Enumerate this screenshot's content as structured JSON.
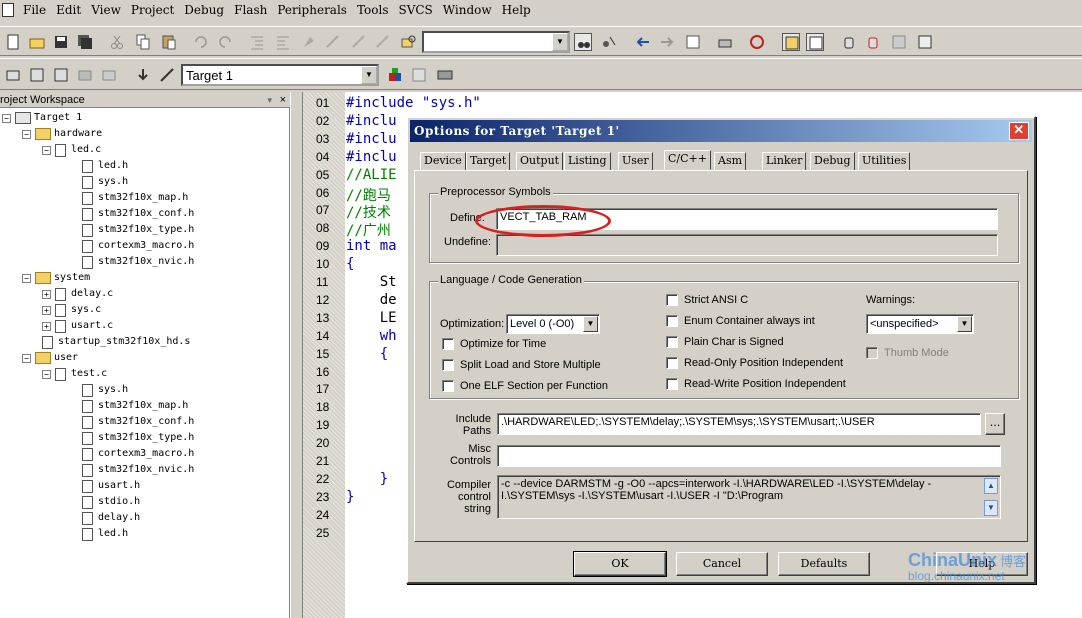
{
  "menu": {
    "items": [
      "File",
      "Edit",
      "View",
      "Project",
      "Debug",
      "Flash",
      "Peripherals",
      "Tools",
      "SVCS",
      "Window",
      "Help"
    ]
  },
  "toolbar2": {
    "target_combo": "Target 1"
  },
  "workspace": {
    "title": "roject Workspace",
    "close": "×",
    "pin": "▾",
    "tree": [
      {
        "label": "Target 1",
        "type": "target",
        "toggle": "−"
      },
      {
        "label": "hardware",
        "type": "folder",
        "toggle": "−"
      },
      {
        "label": "led.c",
        "type": "file",
        "toggle": "−"
      },
      {
        "label": "led.h",
        "type": "file"
      },
      {
        "label": "sys.h",
        "type": "file"
      },
      {
        "label": "stm32f10x_map.h",
        "type": "file"
      },
      {
        "label": "stm32f10x_conf.h",
        "type": "file"
      },
      {
        "label": "stm32f10x_type.h",
        "type": "file"
      },
      {
        "label": "cortexm3_macro.h",
        "type": "file"
      },
      {
        "label": "stm32f10x_nvic.h",
        "type": "file"
      },
      {
        "label": "system",
        "type": "folder",
        "toggle": "−"
      },
      {
        "label": "delay.c",
        "type": "file",
        "toggle": "+"
      },
      {
        "label": "sys.c",
        "type": "file",
        "toggle": "+"
      },
      {
        "label": "usart.c",
        "type": "file",
        "toggle": "+"
      },
      {
        "label": "startup_stm32f10x_hd.s",
        "type": "file"
      },
      {
        "label": "user",
        "type": "folder",
        "toggle": "−"
      },
      {
        "label": "test.c",
        "type": "file",
        "toggle": "−"
      },
      {
        "label": "sys.h",
        "type": "file"
      },
      {
        "label": "stm32f10x_map.h",
        "type": "file"
      },
      {
        "label": "stm32f10x_conf.h",
        "type": "file"
      },
      {
        "label": "stm32f10x_type.h",
        "type": "file"
      },
      {
        "label": "cortexm3_macro.h",
        "type": "file"
      },
      {
        "label": "stm32f10x_nvic.h",
        "type": "file"
      },
      {
        "label": "usart.h",
        "type": "file"
      },
      {
        "label": "stdio.h",
        "type": "file"
      },
      {
        "label": "delay.h",
        "type": "file"
      },
      {
        "label": "led.h",
        "type": "file"
      }
    ]
  },
  "editor": {
    "line_numbers": [
      "01",
      "02",
      "03",
      "04",
      "05",
      "06",
      "07",
      "08",
      "09",
      "10",
      "11",
      "12",
      "13",
      "14",
      "15",
      "16",
      "17",
      "18",
      "19",
      "20",
      "21",
      "22",
      "23",
      "24",
      "25"
    ],
    "lines": [
      {
        "text": "#include \"sys.h\"",
        "cls": "kw"
      },
      {
        "text": "#inclu",
        "cls": "kw"
      },
      {
        "text": "#inclu",
        "cls": "kw"
      },
      {
        "text": "#inclu",
        "cls": "kw"
      },
      {
        "text": "//ALIE",
        "cls": "cmt"
      },
      {
        "text": "//跑马",
        "cls": "cmt"
      },
      {
        "text": "//技术",
        "cls": "cmt"
      },
      {
        "text": "//广州",
        "cls": "cmt"
      },
      {
        "text": "int ma",
        "cls": "kw"
      },
      {
        "text": "{",
        "cls": "kw"
      },
      {
        "text": "    St",
        "cls": ""
      },
      {
        "text": "    de",
        "cls": ""
      },
      {
        "text": "    LE",
        "cls": ""
      },
      {
        "text": "    wh",
        "cls": "kw"
      },
      {
        "text": "    {",
        "cls": "kw"
      },
      {
        "text": "",
        "cls": ""
      },
      {
        "text": "",
        "cls": ""
      },
      {
        "text": "",
        "cls": ""
      },
      {
        "text": "",
        "cls": ""
      },
      {
        "text": "",
        "cls": ""
      },
      {
        "text": "",
        "cls": ""
      },
      {
        "text": "    }",
        "cls": "kw"
      },
      {
        "text": "}",
        "cls": "kw"
      },
      {
        "text": "",
        "cls": ""
      },
      {
        "text": "",
        "cls": ""
      }
    ]
  },
  "dialog": {
    "title": "Options for Target 'Target 1'",
    "close": "✕",
    "tabs": [
      "Device",
      "Target",
      "Output",
      "Listing",
      "User",
      "C/C++",
      "Asm",
      "Linker",
      "Debug",
      "Utilities"
    ],
    "active_tab": "C/C++",
    "preprocessor": {
      "group_label": "Preprocessor Symbols",
      "define_label": "Define:",
      "define_value": "VECT_TAB_RAM",
      "undefine_label": "Undefine:",
      "undefine_value": ""
    },
    "language": {
      "group_label": "Language / Code Generation",
      "optimization_label": "Optimization:",
      "optimization_value": "Level 0 (-O0)",
      "optimize_time": "Optimize for Time",
      "split_load": "Split Load and Store Multiple",
      "one_elf": "One ELF Section per Function",
      "strict_ansi": "Strict ANSI C",
      "enum_container": "Enum Container always int",
      "plain_char": "Plain Char is Signed",
      "ro_pi": "Read-Only Position Independent",
      "rw_pi": "Read-Write Position Independent",
      "warnings_label": "Warnings:",
      "warnings_value": "<unspecified>",
      "thumb_mode": "Thumb Mode"
    },
    "include_paths_label": "Include Paths",
    "include_paths_value": ".\\HARDWARE\\LED;.\\SYSTEM\\delay;.\\SYSTEM\\sys;.\\SYSTEM\\usart;.\\USER",
    "browse": "...",
    "misc_label": "Misc Controls",
    "misc_value": "",
    "compiler_label": "Compiler control string",
    "compiler_line1": "-c --device DARMSTM -g -O0 --apcs=interwork -I.\\HARDWARE\\LED -I.\\SYSTEM\\delay -",
    "compiler_line2": "I.\\SYSTEM\\sys -I.\\SYSTEM\\usart -I.\\USER -I \"D:\\Program",
    "buttons": {
      "ok": "OK",
      "cancel": "Cancel",
      "defaults": "Defaults",
      "help": "Help"
    }
  },
  "watermark": {
    "main": "ChinaUnix",
    "cn": "博客",
    "sub": "blog.chinaunix.net"
  },
  "colors": {
    "title_start": "#0a246a",
    "title_end": "#a6caf0",
    "annotation": "#d82020",
    "comment": "#008000",
    "keyword": "#0000c0"
  }
}
